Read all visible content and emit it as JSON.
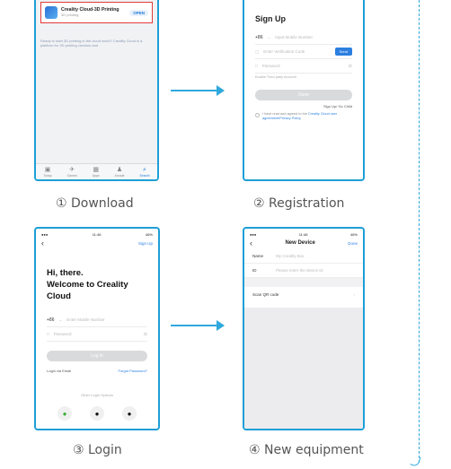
{
  "steps": [
    {
      "caption": "① Download"
    },
    {
      "caption": "② Registration"
    },
    {
      "caption": "③ Login"
    },
    {
      "caption": "④ New equipment"
    }
  ],
  "screen1": {
    "app_name": "Creality Cloud-3D Printing",
    "app_sub": "3D printing",
    "app_button": "OPEN",
    "description": "Ready to start 3D printing in the cloud world? Creality Cloud is a platform for 3D printing creators and",
    "tabs": [
      {
        "icon": "today-icon",
        "glyph": "▣",
        "label": "Today"
      },
      {
        "icon": "games-icon",
        "glyph": "✈",
        "label": "Games"
      },
      {
        "icon": "apps-icon",
        "glyph": "▦",
        "label": "Apps"
      },
      {
        "icon": "arcade-icon",
        "glyph": "♟",
        "label": "Arcade"
      },
      {
        "icon": "search-icon",
        "glyph": "⌕",
        "label": "Search"
      }
    ]
  },
  "screen2": {
    "title": "Sign Up",
    "country_code": "+86",
    "phone_placeholder": "Input Mobile Number",
    "code_placeholder": "Enter Verification Code",
    "send_label": "Send",
    "password_placeholder": "Password",
    "hint": "Enable Third-party Account",
    "submit_label": "Done",
    "have_account": "Sign Up/ Go Child",
    "agree_text": "I have read and agreed to the",
    "agree_link": "Creality Cloud user agreement/Privacy Policy"
  },
  "screen3": {
    "time": "11:46",
    "battery": "46%",
    "signup_link": "Sign Up",
    "greeting_line1": "Hi, there.",
    "greeting_line2": "Welcome to Creality Cloud",
    "country_code": "+86",
    "phone_placeholder": "Enter Mobile Number",
    "password_placeholder": "Password",
    "login_label": "Log in",
    "code_login": "Login via Email",
    "forgot": "Forgot Password?",
    "other_methods": "Other Login Options"
  },
  "screen4": {
    "time": "11:46",
    "battery": "46%",
    "nav_title": "New Device",
    "done_label": "Done",
    "name_label": "Name",
    "name_value": "My Creality Box",
    "id_label": "ID",
    "id_value": "Please enter the device ID",
    "scan_label": "Scan QR code"
  }
}
